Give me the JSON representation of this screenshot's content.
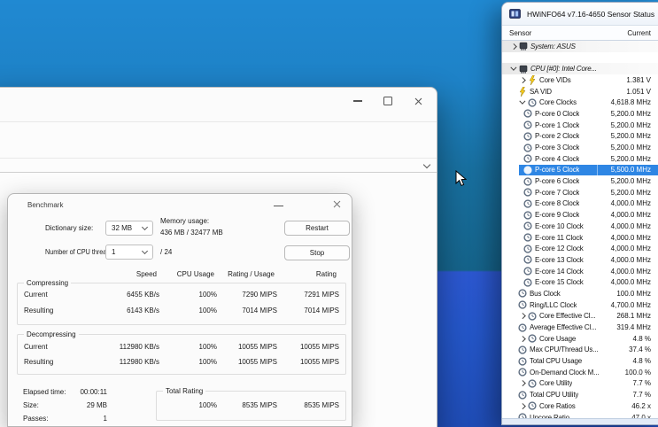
{
  "desktop": {
    "wallpaper_top_color": "#2089d2",
    "wallpaper_mid_color": "#15638a",
    "wallpaper_bottom_color": "#2456c8"
  },
  "benchmark": {
    "title": "Benchmark",
    "dictionary_size": {
      "label": "Dictionary size:",
      "value": "32 MB"
    },
    "memory_usage": {
      "label": "Memory usage:",
      "value": "436 MB / 32477 MB"
    },
    "cpu_threads": {
      "label": "Number of CPU threads:",
      "value": "1",
      "total": "/ 24"
    },
    "buttons": {
      "restart": "Restart",
      "stop": "Stop"
    },
    "table": {
      "headers": [
        "Speed",
        "CPU Usage",
        "Rating / Usage",
        "Rating"
      ],
      "compressing": {
        "label": "Compressing",
        "rows": [
          {
            "name": "Current",
            "speed": "6455 KB/s",
            "cpu": "100%",
            "rating_usage": "7290 MIPS",
            "rating": "7291 MIPS"
          },
          {
            "name": "Resulting",
            "speed": "6143 KB/s",
            "cpu": "100%",
            "rating_usage": "7014 MIPS",
            "rating": "7014 MIPS"
          }
        ]
      },
      "decompressing": {
        "label": "Decompressing",
        "rows": [
          {
            "name": "Current",
            "speed": "112980 KB/s",
            "cpu": "100%",
            "rating_usage": "10055 MIPS",
            "rating": "10055 MIPS"
          },
          {
            "name": "Resulting",
            "speed": "112980 KB/s",
            "cpu": "100%",
            "rating_usage": "10055 MIPS",
            "rating": "10055 MIPS"
          }
        ]
      }
    },
    "summary": {
      "elapsed": {
        "label": "Elapsed time:",
        "value": "00:00:11"
      },
      "size": {
        "label": "Size:",
        "value": "29 MB"
      },
      "passes": {
        "label": "Passes:",
        "value": "1"
      },
      "total_rating": {
        "label": "Total Rating",
        "cpu": "100%",
        "rating_usage": "8535 MIPS",
        "rating": "8535 MIPS"
      }
    }
  },
  "hwinfo": {
    "title": "HWiNFO64 v7.16-4650 Sensor Status",
    "columns": {
      "sensor": "Sensor",
      "current": "Current"
    },
    "selection_color": "#2e86e4",
    "rows": [
      {
        "type": "group",
        "expander": "right",
        "icon": "chip",
        "label": "System: ASUS",
        "value": ""
      },
      {
        "type": "spacer"
      },
      {
        "type": "group",
        "expander": "down",
        "icon": "chip",
        "label": "CPU [#0]: Intel Core...",
        "value": ""
      },
      {
        "type": "item",
        "depth": 1,
        "expander": "right",
        "icon": "bolt",
        "label": "Core VIDs",
        "value": "1.381 V"
      },
      {
        "type": "item",
        "depth": 1,
        "icon": "bolt",
        "label": "SA VID",
        "value": "1.051 V"
      },
      {
        "type": "item",
        "depth": 1,
        "expander": "down",
        "icon": "clock",
        "label": "Core Clocks",
        "value": "4,618.8 MHz"
      },
      {
        "type": "item",
        "depth": 2,
        "icon": "clock",
        "label": "P-core 0 Clock",
        "value": "5,200.0 MHz"
      },
      {
        "type": "item",
        "depth": 2,
        "icon": "clock",
        "label": "P-core 1 Clock",
        "value": "5,200.0 MHz"
      },
      {
        "type": "item",
        "depth": 2,
        "icon": "clock",
        "label": "P-core 2 Clock",
        "value": "5,200.0 MHz"
      },
      {
        "type": "item",
        "depth": 2,
        "icon": "clock",
        "label": "P-core 3 Clock",
        "value": "5,200.0 MHz"
      },
      {
        "type": "item",
        "depth": 2,
        "icon": "clock",
        "label": "P-core 4 Clock",
        "value": "5,200.0 MHz"
      },
      {
        "type": "item",
        "depth": 2,
        "icon": "clock",
        "label": "P-core 5 Clock",
        "value": "5,500.0 MHz",
        "selected": true
      },
      {
        "type": "item",
        "depth": 2,
        "icon": "clock",
        "label": "P-core 6 Clock",
        "value": "5,200.0 MHz"
      },
      {
        "type": "item",
        "depth": 2,
        "icon": "clock",
        "label": "P-core 7 Clock",
        "value": "5,200.0 MHz"
      },
      {
        "type": "item",
        "depth": 2,
        "icon": "clock",
        "label": "E-core 8 Clock",
        "value": "4,000.0 MHz"
      },
      {
        "type": "item",
        "depth": 2,
        "icon": "clock",
        "label": "E-core 9 Clock",
        "value": "4,000.0 MHz"
      },
      {
        "type": "item",
        "depth": 2,
        "icon": "clock",
        "label": "E-core 10 Clock",
        "value": "4,000.0 MHz"
      },
      {
        "type": "item",
        "depth": 2,
        "icon": "clock",
        "label": "E-core 11 Clock",
        "value": "4,000.0 MHz"
      },
      {
        "type": "item",
        "depth": 2,
        "icon": "clock",
        "label": "E-core 12 Clock",
        "value": "4,000.0 MHz"
      },
      {
        "type": "item",
        "depth": 2,
        "icon": "clock",
        "label": "E-core 13 Clock",
        "value": "4,000.0 MHz"
      },
      {
        "type": "item",
        "depth": 2,
        "icon": "clock",
        "label": "E-core 14 Clock",
        "value": "4,000.0 MHz"
      },
      {
        "type": "item",
        "depth": 2,
        "icon": "clock",
        "label": "E-core 15 Clock",
        "value": "4,000.0 MHz"
      },
      {
        "type": "item",
        "depth": 1,
        "icon": "clock",
        "label": "Bus Clock",
        "value": "100.0 MHz"
      },
      {
        "type": "item",
        "depth": 1,
        "icon": "clock",
        "label": "Ring/LLC Clock",
        "value": "4,700.0 MHz"
      },
      {
        "type": "item",
        "depth": 1,
        "expander": "right",
        "icon": "clock",
        "label": "Core Effective Cl...",
        "value": "268.1 MHz"
      },
      {
        "type": "item",
        "depth": 1,
        "icon": "clock",
        "label": "Average Effective Cl...",
        "value": "319.4 MHz"
      },
      {
        "type": "item",
        "depth": 1,
        "expander": "right",
        "icon": "clock",
        "label": "Core Usage",
        "value": "4.8 %"
      },
      {
        "type": "item",
        "depth": 1,
        "icon": "clock",
        "label": "Max CPU/Thread Us...",
        "value": "37.4 %"
      },
      {
        "type": "item",
        "depth": 1,
        "icon": "clock",
        "label": "Total CPU Usage",
        "value": "4.8 %"
      },
      {
        "type": "item",
        "depth": 1,
        "icon": "clock",
        "label": "On-Demand Clock M...",
        "value": "100.0 %"
      },
      {
        "type": "item",
        "depth": 1,
        "expander": "right",
        "icon": "clock",
        "label": "Core Utility",
        "value": "7.7 %"
      },
      {
        "type": "item",
        "depth": 1,
        "icon": "clock",
        "label": "Total CPU Utility",
        "value": "7.7 %"
      },
      {
        "type": "item",
        "depth": 1,
        "expander": "right",
        "icon": "clock",
        "label": "Core Ratios",
        "value": "46.2 x"
      },
      {
        "type": "item",
        "depth": 1,
        "icon": "clock",
        "label": "Uncore Ratio",
        "value": "47.0 x"
      }
    ]
  }
}
